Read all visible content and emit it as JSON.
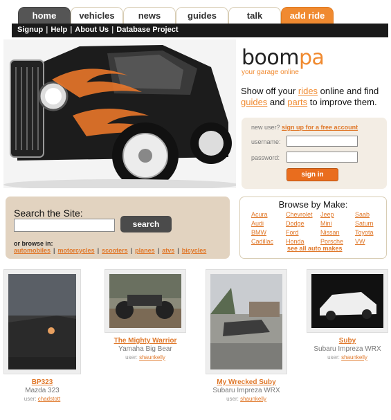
{
  "tabs": [
    "home",
    "vehicles",
    "news",
    "guides",
    "talk",
    "add ride"
  ],
  "nav": [
    "Signup",
    "Help",
    "About Us",
    "Database Project"
  ],
  "logo": {
    "part1": "boom",
    "part2": "pa",
    "tagline": "your garage online"
  },
  "promo": {
    "t1": "Show off your ",
    "rides": "rides",
    "t2": " online and find ",
    "guides": "guides",
    "t3": " and ",
    "parts": "parts",
    "t4": " to improve them."
  },
  "login": {
    "newuser": "new user?",
    "signup_link": "sign up for a free account",
    "username": "username:",
    "password": "password:",
    "signin": "sign in"
  },
  "search": {
    "title": "Search the Site:",
    "button": "search",
    "or_browse": "or browse in:",
    "categories": [
      "automobiles",
      "motorcycles",
      "scooters",
      "planes",
      "atvs",
      "bicycles"
    ]
  },
  "makes": {
    "title": "Browse by Make:",
    "list": [
      "Acura",
      "Chevrolet",
      "Jeep",
      "Saab",
      "Audi",
      "Dodge",
      "Mini",
      "Saturn",
      "BMW",
      "Ford",
      "Nissan",
      "Toyota",
      "Cadillac",
      "Honda",
      "Porsche",
      "VW"
    ],
    "see_all": "see all auto makes"
  },
  "gallery": [
    {
      "title": "BP323",
      "model": "Mazda 323",
      "user_label": "user:",
      "user": "chadstott"
    },
    {
      "title": "The Mighty Warrior",
      "model": "Yamaha Big Bear",
      "user_label": "user:",
      "user": "shaunkelly"
    },
    {
      "title": "My Wrecked Suby",
      "model": "Subaru Impreza WRX",
      "user_label": "user:",
      "user": "shaunkelly"
    },
    {
      "title": "Suby",
      "model": "Subaru Impreza WRX",
      "user_label": "user:",
      "user": "shaunkelly"
    }
  ],
  "colors": {
    "accent": "#f08a30",
    "nav": "#1a1a1a",
    "panel": "#e2d3c0"
  }
}
